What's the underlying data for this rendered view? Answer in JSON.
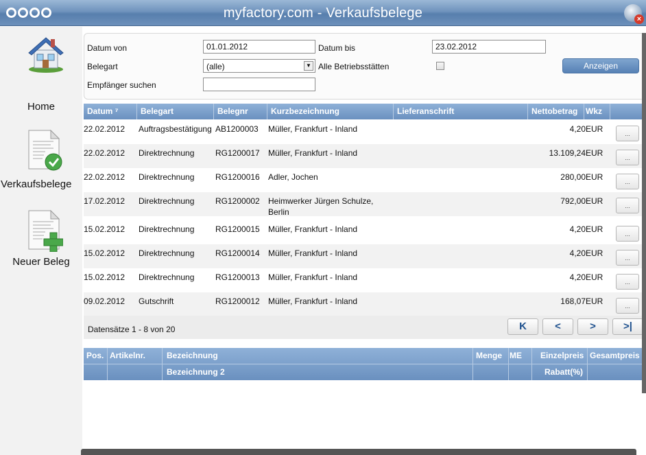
{
  "app": {
    "title": "myfactory.com - Verkaufsbelege"
  },
  "nav": {
    "home": "Home",
    "verkaufsbelege": "Verkaufsbelege",
    "neuer_beleg": "Neuer Beleg"
  },
  "filter": {
    "datum_von_label": "Datum von",
    "datum_von_value": "01.01.2012",
    "datum_bis_label": "Datum bis",
    "datum_bis_value": "23.02.2012",
    "belegart_label": "Belegart",
    "belegart_value": "(alle)",
    "betriebsstaetten_label": "Alle Betriebsstätten",
    "empfaenger_label": "Empfänger suchen",
    "empfaenger_value": "",
    "anzeigen_label": "Anzeigen"
  },
  "table": {
    "headers": {
      "datum": "Datum ⁷",
      "belegart": "Belegart",
      "belegnr": "Belegnr",
      "kurzbezeichnung": "Kurzbezeichnung",
      "lieferanschrift": "Lieferanschrift",
      "nettobetrag": "Nettobetrag",
      "wkz": "Wkz"
    },
    "rows": [
      {
        "datum": "22.02.2012",
        "belegart": "Auftragsbestätigung",
        "belegnr": "AB1200003",
        "kurz": "Müller, Frankfurt - Inland",
        "netto": "4,20",
        "wkz": "EUR",
        "btn": "..."
      },
      {
        "datum": "22.02.2012",
        "belegart": "Direktrechnung",
        "belegnr": "RG1200017",
        "kurz": "Müller, Frankfurt - Inland",
        "netto": "13.109,24",
        "wkz": "EUR",
        "btn": "..."
      },
      {
        "datum": "22.02.2012",
        "belegart": "Direktrechnung",
        "belegnr": "RG1200016",
        "kurz": "Adler, Jochen",
        "netto": "280,00",
        "wkz": "EUR",
        "btn": "..."
      },
      {
        "datum": "17.02.2012",
        "belegart": "Direktrechnung",
        "belegnr": "RG1200002",
        "kurz": "Heimwerker Jürgen Schulze,",
        "kurz2": "Berlin",
        "netto": "792,00",
        "wkz": "EUR",
        "btn": "..."
      },
      {
        "datum": "15.02.2012",
        "belegart": "Direktrechnung",
        "belegnr": "RG1200015",
        "kurz": "Müller, Frankfurt - Inland",
        "netto": "4,20",
        "wkz": "EUR",
        "btn": "..."
      },
      {
        "datum": "15.02.2012",
        "belegart": "Direktrechnung",
        "belegnr": "RG1200014",
        "kurz": "Müller, Frankfurt - Inland",
        "netto": "4,20",
        "wkz": "EUR",
        "btn": "..."
      },
      {
        "datum": "15.02.2012",
        "belegart": "Direktrechnung",
        "belegnr": "RG1200013",
        "kurz": "Müller, Frankfurt - Inland",
        "netto": "4,20",
        "wkz": "EUR",
        "btn": "..."
      },
      {
        "datum": "09.02.2012",
        "belegart": "Gutschrift",
        "belegnr": "RG1200012",
        "kurz": "Müller, Frankfurt - Inland",
        "netto": "168,07",
        "wkz": "EUR",
        "btn": "..."
      }
    ]
  },
  "pager": {
    "info": "Datensätze 1 - 8 von 20",
    "first": "K",
    "prev": "<",
    "next": ">",
    "last": ">|"
  },
  "detail": {
    "headers": {
      "pos": "Pos.",
      "artikelnr": "Artikelnr.",
      "bezeichnung": "Bezeichnung",
      "menge": "Menge",
      "me": "ME",
      "einzelpreis": "Einzelpreis",
      "gesamtpreis": "Gesamtpreis",
      "bezeichnung2": "Bezeichnung 2",
      "rabatt": "Rabatt(%)"
    }
  }
}
